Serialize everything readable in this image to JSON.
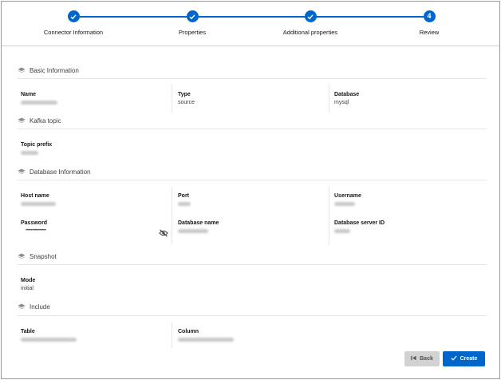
{
  "wizard": {
    "steps": [
      {
        "label": "Connector Information",
        "status": "complete"
      },
      {
        "label": "Properties",
        "status": "complete"
      },
      {
        "label": "Additional properties",
        "status": "complete"
      },
      {
        "label": "Review",
        "status": "current",
        "number": "4"
      }
    ]
  },
  "sections": {
    "basic": {
      "title": "Basic Information",
      "name_label": "Name",
      "type_label": "Type",
      "type_value": "source",
      "database_label": "Database",
      "database_value": "mysql"
    },
    "kafka": {
      "title": "Kafka topic",
      "topic_prefix_label": "Topic prefix"
    },
    "database": {
      "title": "Database Information",
      "host_label": "Host name",
      "port_label": "Port",
      "username_label": "Username",
      "password_label": "Password",
      "password_mask": "••••••••••••••••",
      "dbname_label": "Database name",
      "server_id_label": "Database server ID"
    },
    "snapshot": {
      "title": "Snapshot",
      "mode_label": "Mode",
      "mode_value": "initial"
    },
    "include": {
      "title": "Include",
      "table_label": "Table",
      "column_label": "Column"
    }
  },
  "footer": {
    "back_label": "Back",
    "create_label": "Create"
  },
  "colors": {
    "accent": "#0066cc",
    "border": "#d2d2d2"
  },
  "icons": {
    "section": "layers-icon",
    "complete": "check-icon",
    "toggle": "eye-slash-icon"
  }
}
